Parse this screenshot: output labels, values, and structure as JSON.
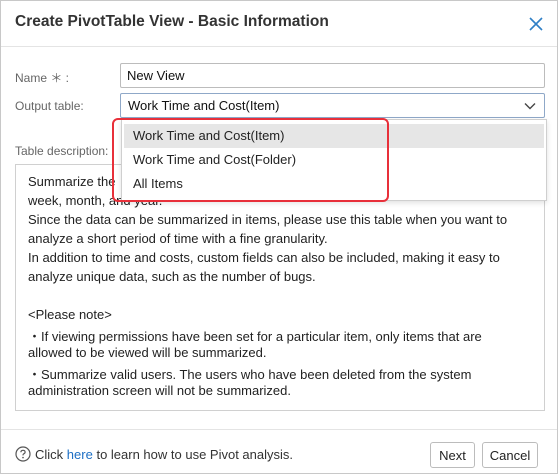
{
  "dialog": {
    "title": "Create PivotTable View - Basic Information",
    "close_icon": "close-icon"
  },
  "form": {
    "name_label": "Name ＊ :",
    "name_value": "New View",
    "output_label": "Output table:",
    "output_value": "Work Time and Cost(Item)",
    "description_label": "Table description:"
  },
  "dropdown": {
    "options": [
      "Work Time and Cost(Item)",
      "Work Time and Cost(Folder)",
      "All Items"
    ],
    "selected_index": 0
  },
  "description": {
    "lines": [
      "Summarize the",
      "week, month, and year.",
      "Since the data can be summarized in items, please use this table when you want to",
      "analyze a short period of time with a fine granularity.",
      "In addition to time and costs, custom fields can also be included, making it easy to",
      "analyze unique data, such as the number of bugs.",
      "",
      "<Please note>",
      "・If viewing permissions have been set for a particular item, only items that are",
      "allowed to be viewed will be summarized.",
      "・Summarize valid users. The users who have been deleted from the system",
      "administration screen will not be summarized."
    ]
  },
  "footer": {
    "help_prefix": "Click",
    "help_link": "here",
    "help_suffix": "to learn how to use Pivot analysis.",
    "next_label": "Next",
    "cancel_label": "Cancel"
  },
  "colors": {
    "link": "#1d6fc4",
    "highlight": "#e8303a",
    "selected_option_bg": "#e6e6e6"
  }
}
